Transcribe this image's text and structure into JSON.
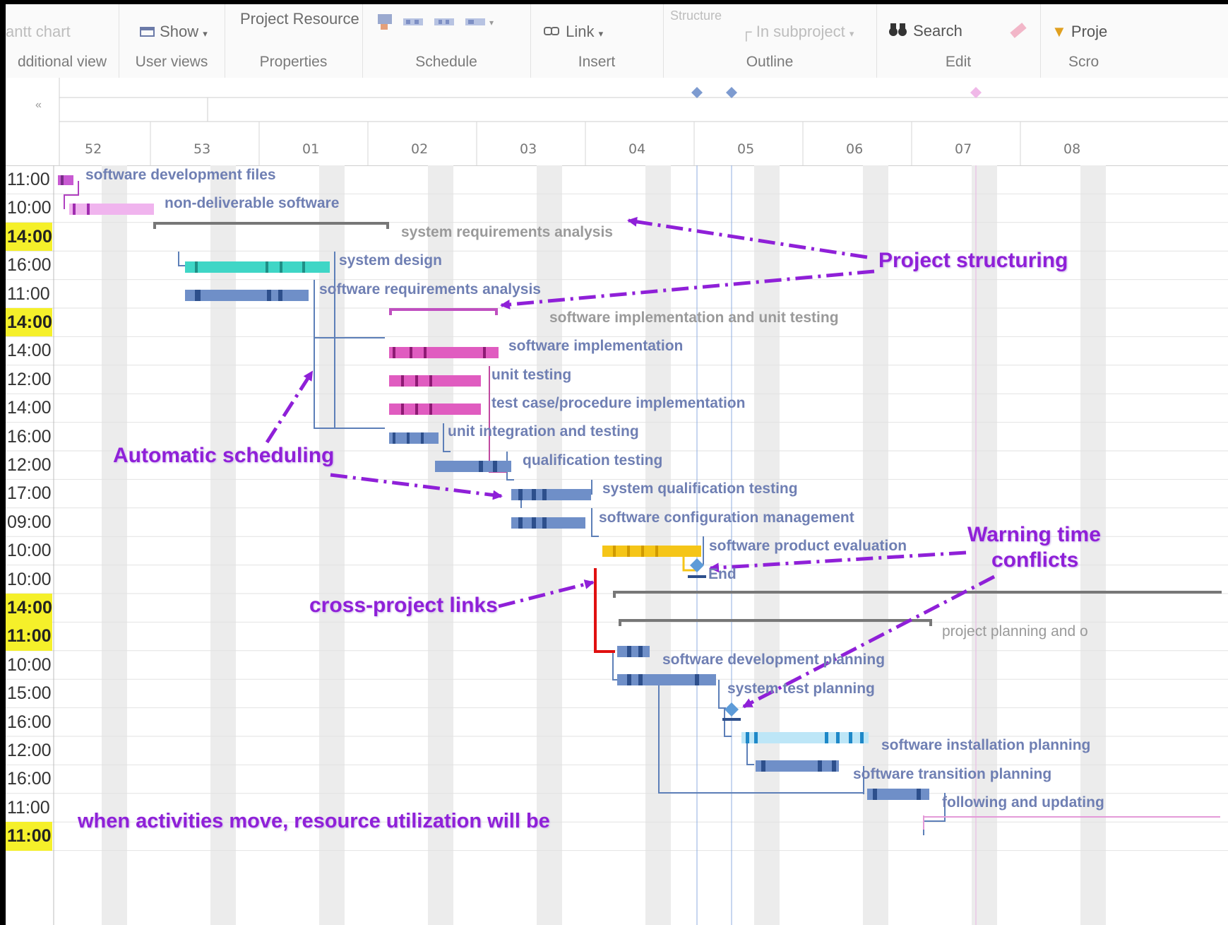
{
  "ribbon": {
    "groups": [
      {
        "button": "antt chart",
        "label": "dditional view"
      },
      {
        "button": "Show",
        "label": "User views"
      },
      {
        "button": "Project  Resource",
        "label": "Properties"
      },
      {
        "button": "",
        "label": "Schedule"
      },
      {
        "button": "Link",
        "label": "Insert"
      },
      {
        "button": "Structure",
        "button2": "In subproject",
        "label": "Outline"
      },
      {
        "button": "Search",
        "label": "Edit"
      },
      {
        "button": "Proje",
        "label": "Scro"
      }
    ]
  },
  "timeline": {
    "collapse_glyph": "«",
    "weeks": [
      "52",
      "53",
      "01",
      "02",
      "03",
      "04",
      "05",
      "06",
      "07",
      "08"
    ]
  },
  "rows": [
    {
      "time": "11:00",
      "highlight": false,
      "task": "software development files"
    },
    {
      "time": "10:00",
      "highlight": false,
      "task": "non-deliverable software"
    },
    {
      "time": "14:00",
      "highlight": true,
      "task": "system requirements analysis"
    },
    {
      "time": "16:00",
      "highlight": false,
      "task": "system design"
    },
    {
      "time": "11:00",
      "highlight": false,
      "task": "software requirements analysis"
    },
    {
      "time": "14:00",
      "highlight": true,
      "task": "software implementation and unit testing"
    },
    {
      "time": "14:00",
      "highlight": false,
      "task": "software implementation"
    },
    {
      "time": "12:00",
      "highlight": false,
      "task": "unit testing"
    },
    {
      "time": "14:00",
      "highlight": false,
      "task": "test case/procedure implementation"
    },
    {
      "time": "16:00",
      "highlight": false,
      "task": "unit integration and testing"
    },
    {
      "time": "12:00",
      "highlight": false,
      "task": "qualification testing"
    },
    {
      "time": "17:00",
      "highlight": false,
      "task": "system qualification testing"
    },
    {
      "time": "09:00",
      "highlight": false,
      "task": "software configuration management"
    },
    {
      "time": "10:00",
      "highlight": false,
      "task": "software product evaluation"
    },
    {
      "time": "10:00",
      "highlight": false,
      "task": "End"
    },
    {
      "time": "14:00",
      "highlight": true,
      "task": ""
    },
    {
      "time": "11:00",
      "highlight": true,
      "task": "project planning and o"
    },
    {
      "time": "10:00",
      "highlight": false,
      "task": "software development planning"
    },
    {
      "time": "15:00",
      "highlight": false,
      "task": "system test planning"
    },
    {
      "time": "16:00",
      "highlight": false,
      "task": ""
    },
    {
      "time": "12:00",
      "highlight": false,
      "task": "software installation planning"
    },
    {
      "time": "16:00",
      "highlight": false,
      "task": "software transition planning"
    },
    {
      "time": "11:00",
      "highlight": false,
      "task": "following and updating"
    },
    {
      "time": "11:00",
      "highlight": true,
      "task": ""
    }
  ],
  "annotations": {
    "project_structuring": "Project structuring",
    "automatic_scheduling": "Automatic scheduling",
    "warning_time_1": "Warning time",
    "warning_time_2": "conflicts",
    "cross_project": "cross-project links",
    "resource_note": "when activities move, resource utilization will be"
  },
  "colors": {
    "annotation": "#8f20d8",
    "highlight": "#f5f02a",
    "bar_blue": "#6f8fc8",
    "bar_teal": "#3fd6c6",
    "bar_pink": "#e05cc0",
    "bar_light_pink": "#f0b4ee",
    "bar_yellow": "#f5c518",
    "bar_light_blue": "#bde6f7",
    "critical_link": "#e01010"
  }
}
